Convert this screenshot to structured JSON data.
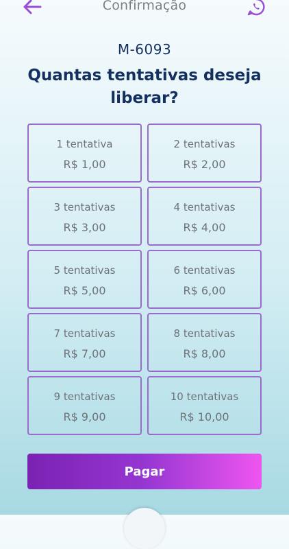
{
  "header": {
    "title": "Confirmação",
    "back_icon": "arrow-left-icon",
    "whatsapp_icon": "whatsapp-icon",
    "accent_color": "#9b4dd6"
  },
  "code": "M-6093",
  "question": "Quantas tentativas deseja liberar?",
  "options": [
    {
      "label": "1 tentativa",
      "price": "R$ 1,00"
    },
    {
      "label": "2 tentativas",
      "price": "R$ 2,00"
    },
    {
      "label": "3 tentativas",
      "price": "R$ 3,00"
    },
    {
      "label": "4 tentativas",
      "price": "R$ 4,00"
    },
    {
      "label": "5 tentativas",
      "price": "R$ 5,00"
    },
    {
      "label": "6 tentativas",
      "price": "R$ 6,00"
    },
    {
      "label": "7 tentativas",
      "price": "R$ 7,00"
    },
    {
      "label": "8 tentativas",
      "price": "R$ 8,00"
    },
    {
      "label": "9 tentativas",
      "price": "R$ 9,00"
    },
    {
      "label": "10 tentativas",
      "price": "R$ 10,00"
    }
  ],
  "pay_button": {
    "label": "Pagar",
    "gradient_start": "#7b22b3",
    "gradient_end": "#ee55ef"
  },
  "colors": {
    "title_text": "#13305f",
    "option_border": "#9a6bcc",
    "option_text": "#6e7278"
  }
}
